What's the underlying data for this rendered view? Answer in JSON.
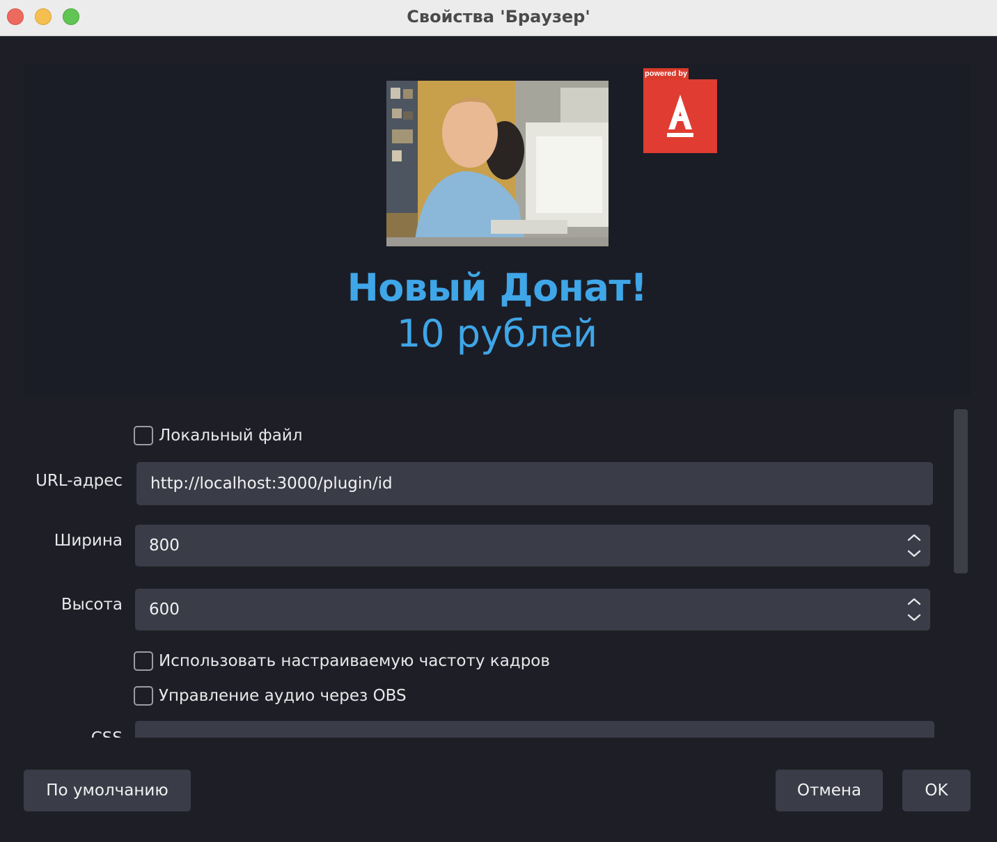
{
  "window": {
    "title": "Свойства 'Браузер'"
  },
  "preview": {
    "powered_by": "powered by",
    "alert_title": "Новый Донат!",
    "alert_amount": "10 рублей"
  },
  "form": {
    "local_file_label": "Локальный файл",
    "url_label": "URL-адрес",
    "url_value": "http://localhost:3000/plugin/id",
    "width_label": "Ширина",
    "width_value": "800",
    "height_label": "Высота",
    "height_value": "600",
    "custom_fps_label": "Использовать настраиваемую частоту кадров",
    "obs_audio_label": "Управление аудио через OBS",
    "css_label": "CSS"
  },
  "buttons": {
    "defaults": "По умолчанию",
    "cancel": "Отмена",
    "ok": "OK"
  },
  "colors": {
    "accent_text": "#3fa6e8",
    "brand_red": "#e03c31",
    "background": "#1e1f26",
    "field_bg": "#3a3c48"
  }
}
